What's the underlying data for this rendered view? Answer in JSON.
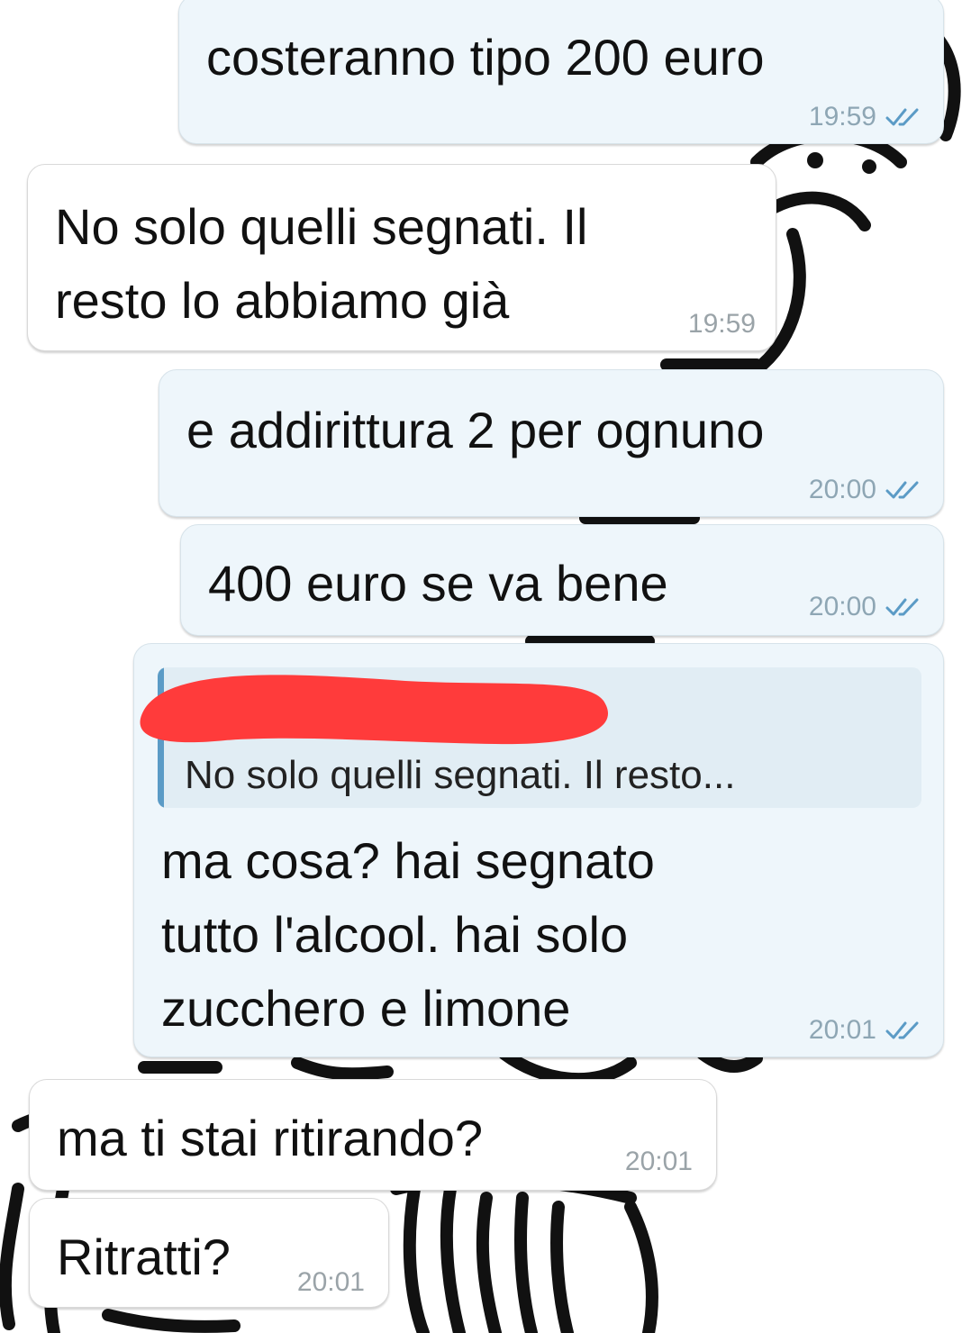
{
  "chat": {
    "messages": [
      {
        "direction": "outgoing",
        "text": "costeranno tipo 200 euro",
        "time": "19:59",
        "read": true
      },
      {
        "direction": "incoming",
        "lines": [
          "No solo quelli segnati. Il",
          "resto lo abbiamo già"
        ],
        "time": "19:59"
      },
      {
        "direction": "outgoing",
        "text": "e addirittura 2 per ognuno",
        "time": "20:00",
        "read": true
      },
      {
        "direction": "outgoing",
        "text": "400 euro se va bene",
        "time": "20:00",
        "read": true
      },
      {
        "direction": "outgoing",
        "quote": {
          "sender": "",
          "text": "No solo quelli segnati. Il resto..."
        },
        "lines": [
          "ma cosa? hai segnato",
          "tutto l'alcool. hai solo",
          "zucchero e limone"
        ],
        "time": "20:01",
        "read": true
      },
      {
        "direction": "incoming",
        "text": "ma ti stai ritirando?",
        "time": "20:01"
      },
      {
        "direction": "incoming",
        "text": "Ritratti?",
        "time": "20:01"
      }
    ]
  },
  "colors": {
    "outgoing_bubble": "#eef6fb",
    "incoming_bubble": "#ffffff",
    "read_check": "#5b9bc6",
    "quote_bar": "#5b9bc6",
    "redaction": "#ff3b3b"
  },
  "icons": {
    "read_receipt": "double-check-icon"
  }
}
